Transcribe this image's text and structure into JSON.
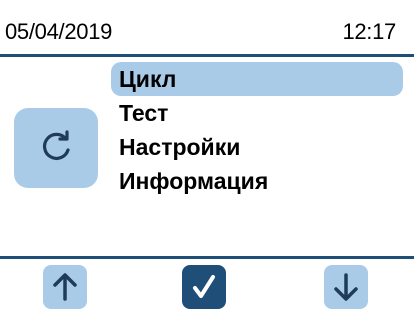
{
  "status_bar": {
    "date": "05/04/2019",
    "time": "12:17"
  },
  "main_icon": "refresh-cycle-icon",
  "menu": {
    "items": [
      {
        "label": "Цикл",
        "selected": true
      },
      {
        "label": "Тест",
        "selected": false
      },
      {
        "label": "Настройки",
        "selected": false
      },
      {
        "label": "Информация",
        "selected": false
      }
    ]
  },
  "buttons": {
    "up_icon": "arrow-up-icon",
    "ok_icon": "check-icon",
    "down_icon": "arrow-down-icon"
  },
  "colors": {
    "accent": "#1f4e79",
    "highlight": "#a9cbe8",
    "background": "#ffffff"
  }
}
